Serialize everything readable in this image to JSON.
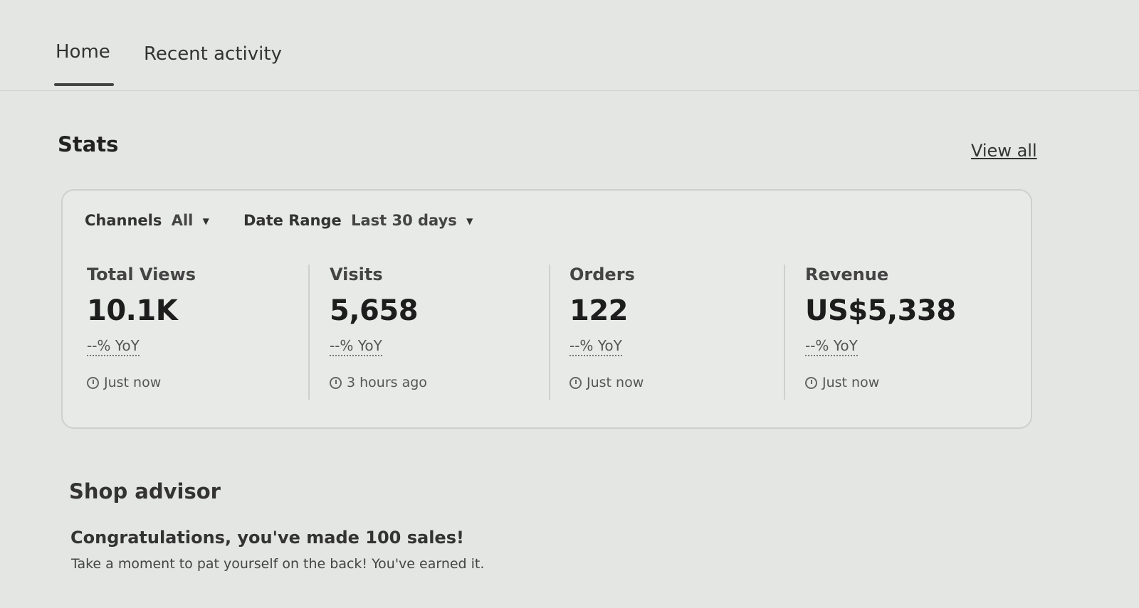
{
  "tabs": [
    {
      "label": "Home",
      "active": true
    },
    {
      "label": "Recent activity",
      "active": false
    }
  ],
  "stats": {
    "title": "Stats",
    "view_all": "View all",
    "filters": {
      "channels_label": "Channels",
      "channels_value": "All",
      "date_range_label": "Date Range",
      "date_range_value": "Last 30 days"
    },
    "metrics": [
      {
        "label": "Total Views",
        "value": "10.1K",
        "yoy": "--% YoY",
        "updated": "Just now"
      },
      {
        "label": "Visits",
        "value": "5,658",
        "yoy": "--% YoY",
        "updated": "3 hours ago"
      },
      {
        "label": "Orders",
        "value": "122",
        "yoy": "--% YoY",
        "updated": "Just now"
      },
      {
        "label": "Revenue",
        "value": "US$5,338",
        "yoy": "--% YoY",
        "updated": "Just now"
      }
    ]
  },
  "shop_advisor": {
    "title": "Shop advisor",
    "heading": "Congratulations, you've made 100 sales!",
    "body": "Take a moment to pat yourself on the back! You've earned it."
  },
  "icons": {
    "caret": "caret-down-icon",
    "clock": "clock-icon"
  }
}
